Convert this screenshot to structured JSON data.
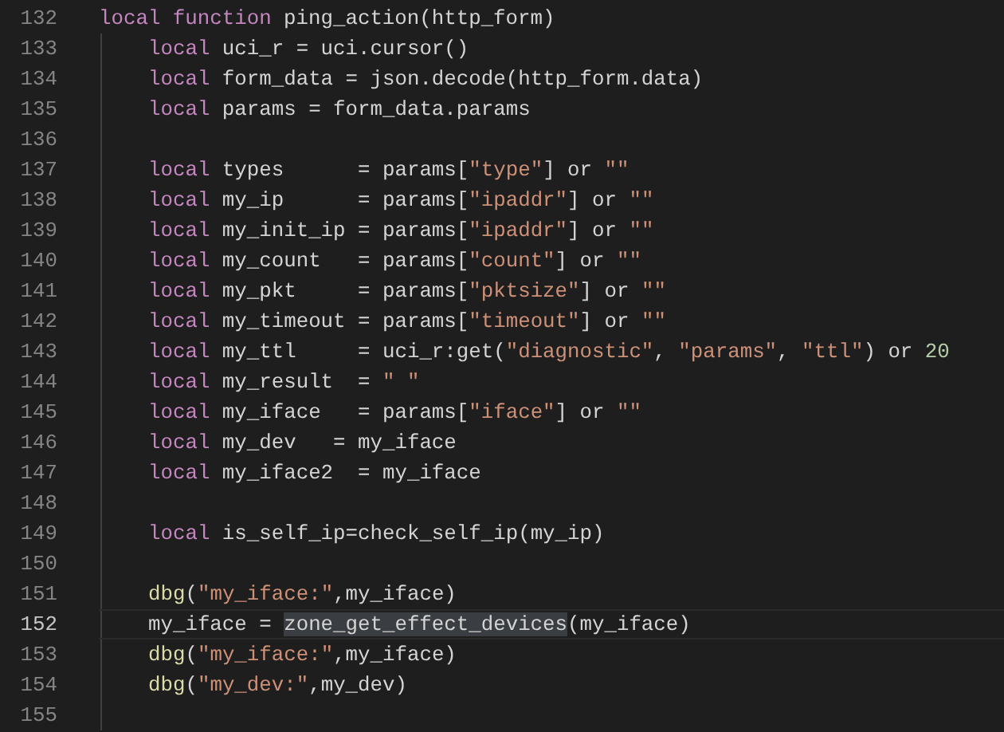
{
  "editor": {
    "lines": [
      {
        "number": "132",
        "current": false,
        "indented": false,
        "tokens": [
          {
            "kind": "keyword",
            "text": "local function"
          },
          {
            "kind": "plain",
            "text": " ping_action(http_form)"
          }
        ]
      },
      {
        "number": "133",
        "current": false,
        "indented": true,
        "tokens": [
          {
            "kind": "keyword",
            "text": "local"
          },
          {
            "kind": "plain",
            "text": " uci_r = uci.cursor()"
          }
        ]
      },
      {
        "number": "134",
        "current": false,
        "indented": true,
        "tokens": [
          {
            "kind": "keyword",
            "text": "local"
          },
          {
            "kind": "plain",
            "text": " form_data = json.decode(http_form.data)"
          }
        ]
      },
      {
        "number": "135",
        "current": false,
        "indented": true,
        "tokens": [
          {
            "kind": "keyword",
            "text": "local"
          },
          {
            "kind": "plain",
            "text": " params = form_data.params"
          }
        ]
      },
      {
        "number": "136",
        "current": false,
        "indented": true
      },
      {
        "number": "137",
        "current": false,
        "indented": true,
        "tokens": [
          {
            "kind": "keyword",
            "text": "local"
          },
          {
            "kind": "plain",
            "text": " types      = params["
          },
          {
            "kind": "string",
            "text": "\"type\""
          },
          {
            "kind": "plain",
            "text": "] or "
          },
          {
            "kind": "string",
            "text": "\"\""
          }
        ]
      },
      {
        "number": "138",
        "current": false,
        "indented": true,
        "tokens": [
          {
            "kind": "keyword",
            "text": "local"
          },
          {
            "kind": "plain",
            "text": " my_ip      = params["
          },
          {
            "kind": "string",
            "text": "\"ipaddr\""
          },
          {
            "kind": "plain",
            "text": "] or "
          },
          {
            "kind": "string",
            "text": "\"\""
          }
        ]
      },
      {
        "number": "139",
        "current": false,
        "indented": true,
        "tokens": [
          {
            "kind": "keyword",
            "text": "local"
          },
          {
            "kind": "plain",
            "text": " my_init_ip = params["
          },
          {
            "kind": "string",
            "text": "\"ipaddr\""
          },
          {
            "kind": "plain",
            "text": "] or "
          },
          {
            "kind": "string",
            "text": "\"\""
          }
        ]
      },
      {
        "number": "140",
        "current": false,
        "indented": true,
        "tokens": [
          {
            "kind": "keyword",
            "text": "local"
          },
          {
            "kind": "plain",
            "text": " my_count   = params["
          },
          {
            "kind": "string",
            "text": "\"count\""
          },
          {
            "kind": "plain",
            "text": "] or "
          },
          {
            "kind": "string",
            "text": "\"\""
          }
        ]
      },
      {
        "number": "141",
        "current": false,
        "indented": true,
        "tokens": [
          {
            "kind": "keyword",
            "text": "local"
          },
          {
            "kind": "plain",
            "text": " my_pkt     = params["
          },
          {
            "kind": "string",
            "text": "\"pktsize\""
          },
          {
            "kind": "plain",
            "text": "] or "
          },
          {
            "kind": "string",
            "text": "\"\""
          }
        ]
      },
      {
        "number": "142",
        "current": false,
        "indented": true,
        "tokens": [
          {
            "kind": "keyword",
            "text": "local"
          },
          {
            "kind": "plain",
            "text": " my_timeout = params["
          },
          {
            "kind": "string",
            "text": "\"timeout\""
          },
          {
            "kind": "plain",
            "text": "] or "
          },
          {
            "kind": "string",
            "text": "\"\""
          }
        ]
      },
      {
        "number": "143",
        "current": false,
        "indented": true,
        "tokens": [
          {
            "kind": "keyword",
            "text": "local"
          },
          {
            "kind": "plain",
            "text": " my_ttl     = uci_r:get("
          },
          {
            "kind": "string",
            "text": "\"diagnostic\""
          },
          {
            "kind": "plain",
            "text": ", "
          },
          {
            "kind": "string",
            "text": "\"params\""
          },
          {
            "kind": "plain",
            "text": ", "
          },
          {
            "kind": "string",
            "text": "\"ttl\""
          },
          {
            "kind": "plain",
            "text": ") or "
          },
          {
            "kind": "number",
            "text": "20"
          }
        ]
      },
      {
        "number": "144",
        "current": false,
        "indented": true,
        "tokens": [
          {
            "kind": "keyword",
            "text": "local"
          },
          {
            "kind": "plain",
            "text": " my_result  = "
          },
          {
            "kind": "string",
            "text": "\" \""
          }
        ]
      },
      {
        "number": "145",
        "current": false,
        "indented": true,
        "tokens": [
          {
            "kind": "keyword",
            "text": "local"
          },
          {
            "kind": "plain",
            "text": " my_iface   = params["
          },
          {
            "kind": "string",
            "text": "\"iface\""
          },
          {
            "kind": "plain",
            "text": "] or "
          },
          {
            "kind": "string",
            "text": "\"\""
          }
        ]
      },
      {
        "number": "146",
        "current": false,
        "indented": true,
        "tokens": [
          {
            "kind": "keyword",
            "text": "local"
          },
          {
            "kind": "plain",
            "text": " my_dev   = my_iface"
          }
        ]
      },
      {
        "number": "147",
        "current": false,
        "indented": true,
        "tokens": [
          {
            "kind": "keyword",
            "text": "local"
          },
          {
            "kind": "plain",
            "text": " my_iface2  = my_iface"
          }
        ]
      },
      {
        "number": "148",
        "current": false,
        "indented": true
      },
      {
        "number": "149",
        "current": false,
        "indented": true,
        "tokens": [
          {
            "kind": "keyword",
            "text": "local"
          },
          {
            "kind": "plain",
            "text": " is_self_ip=check_self_ip(my_ip)"
          }
        ]
      },
      {
        "number": "150",
        "current": false,
        "indented": true
      },
      {
        "number": "151",
        "current": false,
        "indented": true,
        "tokens": [
          {
            "kind": "function",
            "text": "dbg"
          },
          {
            "kind": "plain",
            "text": "("
          },
          {
            "kind": "string",
            "text": "\"my_iface:\""
          },
          {
            "kind": "plain",
            "text": ",my_iface)"
          }
        ]
      },
      {
        "number": "152",
        "current": true,
        "indented": true,
        "tokens": [
          {
            "kind": "plain",
            "text": "my_iface = "
          },
          {
            "kind": "selected",
            "text": "zone_get_effect_devices"
          },
          {
            "kind": "plain",
            "text": "(my_iface)"
          }
        ]
      },
      {
        "number": "153",
        "current": false,
        "indented": true,
        "tokens": [
          {
            "kind": "function",
            "text": "dbg"
          },
          {
            "kind": "plain",
            "text": "("
          },
          {
            "kind": "string",
            "text": "\"my_iface:\""
          },
          {
            "kind": "plain",
            "text": ",my_iface)"
          }
        ]
      },
      {
        "number": "154",
        "current": false,
        "indented": true,
        "tokens": [
          {
            "kind": "function",
            "text": "dbg"
          },
          {
            "kind": "plain",
            "text": "("
          },
          {
            "kind": "string",
            "text": "\"my_dev:\""
          },
          {
            "kind": "plain",
            "text": ",my_dev)"
          }
        ]
      },
      {
        "number": "155",
        "current": false,
        "indented": true
      }
    ]
  }
}
